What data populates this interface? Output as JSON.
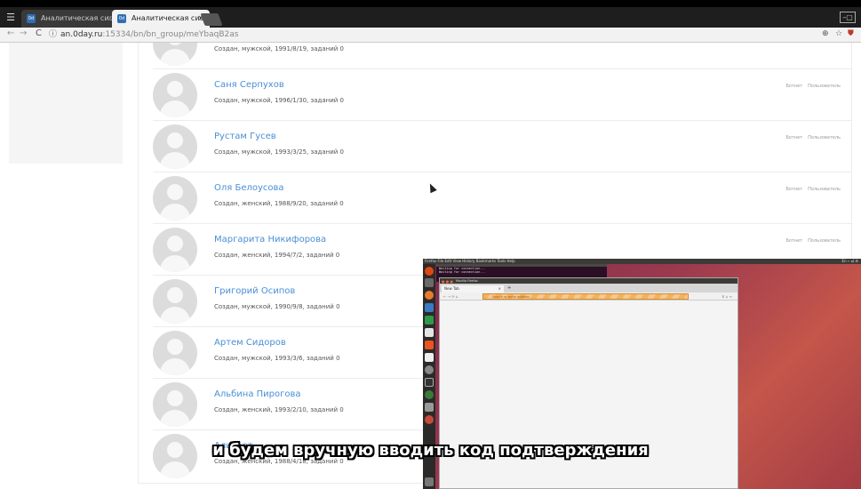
{
  "browser": {
    "tabs": [
      {
        "label": "Аналитическая сис",
        "active": false
      },
      {
        "label": "Аналитическая сис",
        "active": true
      }
    ],
    "tab_close": "×",
    "url_host": "an.0day.ru",
    "url_path": ":15334/bn/bn_group/meYbaqB2as",
    "nav_back": "←",
    "nav_forward": "→",
    "nav_reload": "C",
    "info_glyph": "ⓘ",
    "star_glyph": "☆"
  },
  "users": [
    {
      "name": "",
      "meta": "Создан, мужской, 1991/8/19, заданий 0",
      "badges": []
    },
    {
      "name": "Саня Серпухов",
      "meta": "Создан, мужской, 1996/1/30, заданий 0",
      "badges": [
        "Ботнет",
        "Пользователь"
      ]
    },
    {
      "name": "Рустам Гусев",
      "meta": "Создан, мужской, 1993/3/25, заданий 0",
      "badges": [
        "Ботнет",
        "Пользователь"
      ]
    },
    {
      "name": "Оля Белоусова",
      "meta": "Создан, женский, 1988/9/20, заданий 0",
      "badges": [
        "Ботнет",
        "Пользователь"
      ]
    },
    {
      "name": "Маргарита Никифорова",
      "meta": "Создан, женский, 1994/7/2, заданий 0",
      "badges": [
        "Ботнет",
        "Пользователь"
      ]
    },
    {
      "name": "Григорий Осипов",
      "meta": "Создан, мужской, 1990/9/8, заданий 0",
      "badges": []
    },
    {
      "name": "Артем Сидоров",
      "meta": "Создан, мужской, 1993/3/6, заданий 0",
      "badges": []
    },
    {
      "name": "Альбина Пирогова",
      "meta": "Создан, женский, 1993/2/10, заданий 0",
      "badges": []
    },
    {
      "name": "Альберт",
      "meta": "Создан, женский, 1988/4/18, заданий 0",
      "badges": []
    }
  ],
  "vm": {
    "panel_left": "Firefox  File  Edit  View  History  Bookmarks  Tools  Help",
    "panel_right": "En  ⌁  ◂)  ⚙",
    "terminal_lines": [
      "Waiting for connection...",
      "Waiting for connection..."
    ],
    "window_title": "Mozilla Firefox",
    "tab_label": "New Tab",
    "search_placeholder": "Search or enter address"
  },
  "subtitle": "и будем вручную вводить код подтверждения"
}
